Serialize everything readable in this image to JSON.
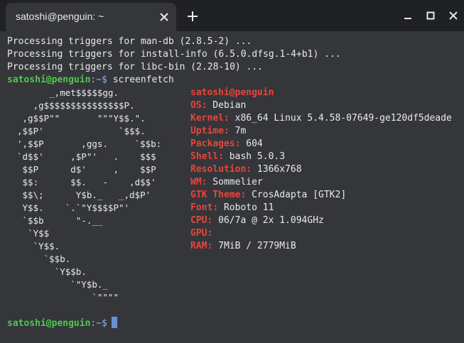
{
  "window": {
    "tab_title": "satoshi@penguin: ~",
    "close_glyph": "✕",
    "new_tab_glyph": "+",
    "minimize_glyph": "—",
    "maximize_glyph": "☐",
    "window_close_glyph": "✕"
  },
  "terminal": {
    "output_lines": [
      "Processing triggers for man-db (2.8.5-2) ...",
      "Processing triggers for install-info (6.5.0.dfsg.1-4+b1) ...",
      "Processing triggers for libc-bin (2.28-10) ..."
    ],
    "prompt_user": "satoshi@penguin",
    "prompt_path": ":~$",
    "command": " screenfetch",
    "logo_lines": [
      "      _,met$$$$$gg.",
      "   ,g$$$$$$$$$$$$$$$P.",
      " ,g$$P\"\"       \"\"\"Y$$.\".",
      ",$$P'              `$$$.",
      "',$$P       ,ggs.     `$$b:",
      "`d$$'     ,$P\"'   .    $$$",
      " $$P      d$'     ,    $$P",
      " $$:      $$.   -    ,d$$'",
      " $$\\;      Y$b._   _,d$P'",
      " Y$$.    `.`\"Y$$$$P\"'",
      " `$$b      \"-.__",
      "  `Y$$",
      "   `Y$$.",
      "     `$$b.",
      "       `Y$$b.",
      "          `\"Y$b._",
      "              `\"\"\"\""
    ],
    "info": {
      "user_host": "satoshi@penguin",
      "rows": [
        {
          "key": "OS:",
          "value": " Debian"
        },
        {
          "key": "Kernel:",
          "value": " x86_64 Linux 5.4.58-07649-ge120df5deade"
        },
        {
          "key": "Uptime:",
          "value": " 7m"
        },
        {
          "key": "Packages:",
          "value": " 604"
        },
        {
          "key": "Shell:",
          "value": " bash 5.0.3"
        },
        {
          "key": "Resolution:",
          "value": " 1366x768"
        },
        {
          "key": "WM:",
          "value": " Sommelier"
        },
        {
          "key": "GTK Theme:",
          "value": " CrosAdapta [GTK2]"
        },
        {
          "key": "Font:",
          "value": " Roboto 11"
        },
        {
          "key": "CPU:",
          "value": " 06/7a @ 2x 1.094GHz"
        },
        {
          "key": "GPU:",
          "value": ""
        },
        {
          "key": "RAM:",
          "value": " 7MiB / 2779MiB"
        }
      ]
    },
    "final_prompt_user": "satoshi@penguin",
    "final_prompt_path": ":~$"
  },
  "colors": {
    "prompt_user": "#4ec94e",
    "prompt_path": "#8ab4f8",
    "info_key": "#e8453c",
    "background": "#35363a"
  }
}
